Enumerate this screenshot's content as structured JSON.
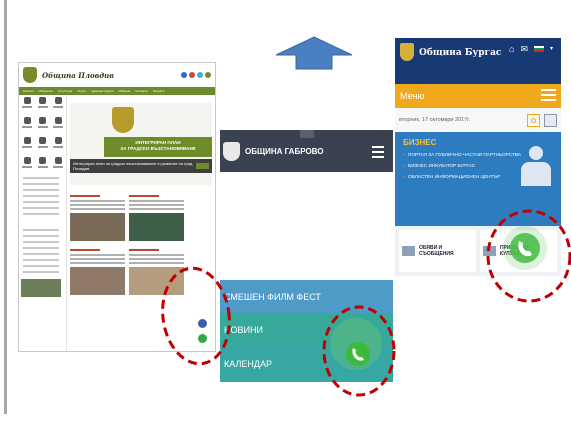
{
  "plovdiv": {
    "title": "Община Пловдив",
    "nav": [
      "Начало",
      "Общинска",
      "Структура",
      "Услуги",
      "Администрация",
      "Изборни",
      "Контакти",
      "Проекти"
    ],
    "banner_line1": "ИНТЕГРИРАН ПЛАН",
    "banner_line2": "ЗА ГРАДСКО ВЪЗСТАНОВЯВАНЕ",
    "search_text": "Интегриран план за градско възстановяване и развитие на град Пловдив",
    "colors": {
      "brand": "#6d8a2c",
      "accent": "#b94b2c"
    },
    "icons": [
      "crest-icon",
      "social-icon",
      "chat-bubble-icon",
      "phone-icon"
    ]
  },
  "gabrovo": {
    "title": "ОБЩИНА ГАБРОВО",
    "menu": [
      "СМЕШЕН ФИЛМ ФЕСТ",
      "НОВИНИ",
      "КАЛЕНДАР"
    ],
    "colors": {
      "header": "#3a4150",
      "row1": "#4f9bc8",
      "row2": "#37a99a"
    },
    "icons": [
      "crest-icon",
      "hamburger-icon",
      "phone-icon"
    ]
  },
  "burgas": {
    "title": "Община Бургас",
    "menu_label": "Меню",
    "date": "вторник, 17 октомври 2017г.",
    "business": {
      "title": "БИЗНЕС",
      "items": [
        "ПОРТАЛ ЗА ПУБЛИЧНО-ЧАСТНИ ПАРТНЬОРСТВА",
        "БИЗНЕС ИНКУБАТОР БУРГАС",
        "ОБЛАСТЕН ИНФОРМАЦИОНЕН ЦЕНТЪР"
      ]
    },
    "tiles": [
      "ОБЯВИ И СЪОБЩЕНИЯ",
      "ПРИЗИВ НА КУЛУВАНА"
    ],
    "colors": {
      "header": "#173a74",
      "menu": "#f0a81c",
      "business": "#2e7cc0"
    },
    "icons": [
      "home-icon",
      "mail-icon",
      "flag-icon",
      "search-icon",
      "calendar-icon",
      "phone-icon"
    ]
  },
  "annotations": {
    "arrow_color": "#4a7fc1",
    "circle_color": "#c00000",
    "phone_color": "#3cba3c"
  }
}
